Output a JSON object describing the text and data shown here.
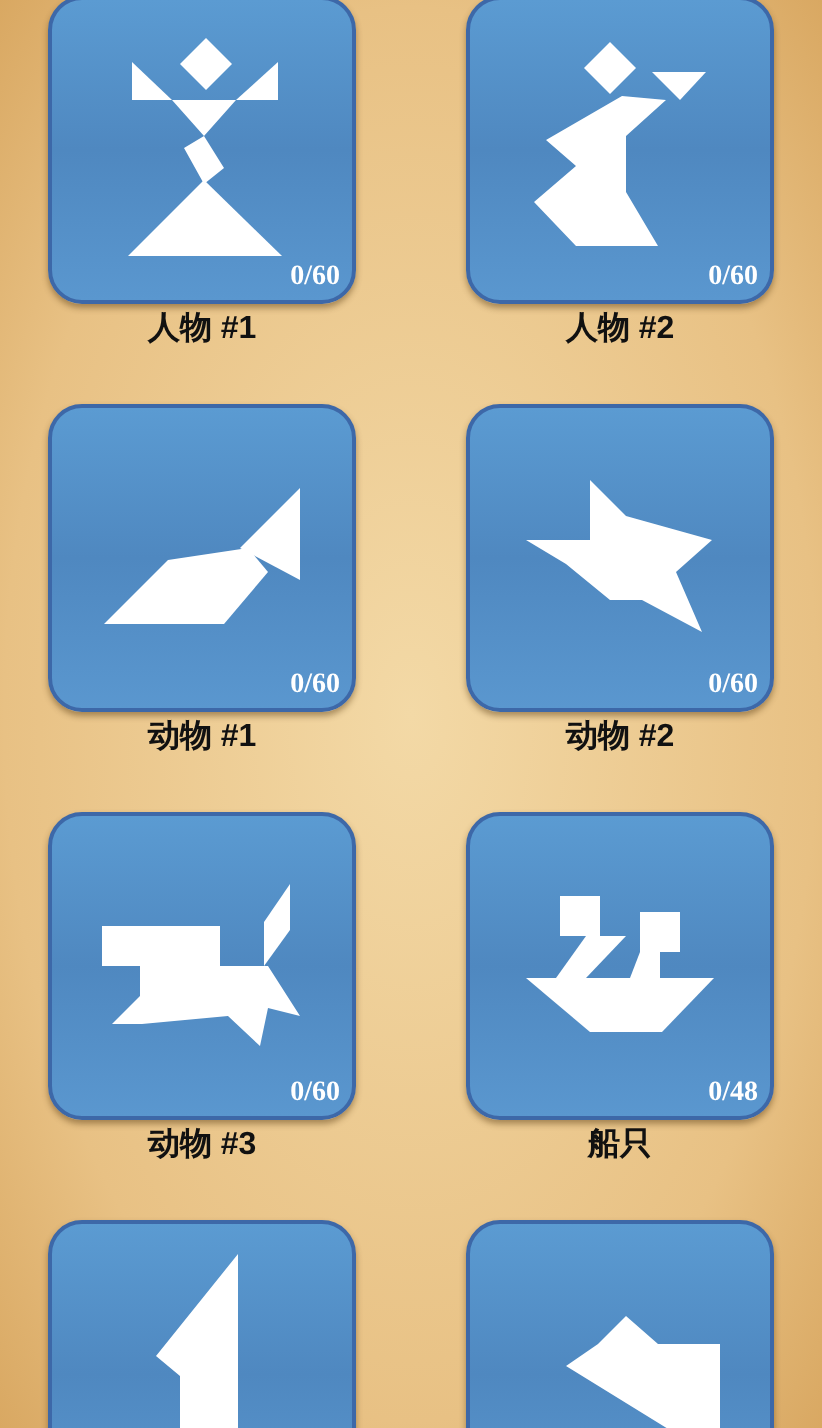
{
  "levels": [
    {
      "kind": "full",
      "label": "人物 #1",
      "count": "0/60"
    },
    {
      "kind": "full",
      "label": "人物 #2",
      "count": "0/60"
    },
    {
      "kind": "full",
      "label": "动物 #1",
      "count": "0/60"
    },
    {
      "kind": "full",
      "label": "动物 #2",
      "count": "0/60"
    },
    {
      "kind": "full",
      "label": "动物 #3",
      "count": "0/60"
    },
    {
      "kind": "full",
      "label": "船只",
      "count": "0/48"
    },
    {
      "kind": "cut"
    },
    {
      "kind": "cut"
    }
  ]
}
